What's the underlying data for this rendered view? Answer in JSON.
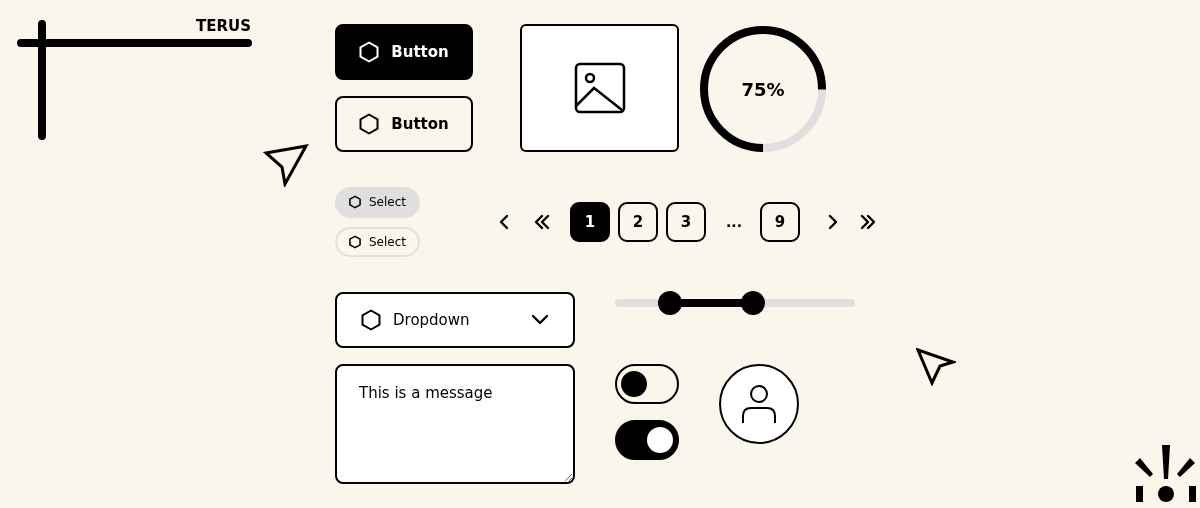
{
  "logo": {
    "text": "TERUS"
  },
  "buttons": [
    {
      "label": "Button",
      "kind": "filled"
    },
    {
      "label": "Button",
      "kind": "outline"
    }
  ],
  "progress": {
    "level": 0.75,
    "reading": "75%"
  },
  "chips": [
    {
      "label": "Select",
      "selected": true
    },
    {
      "label": "Select",
      "selected": false
    }
  ],
  "pagination": [
    {
      "kind": "prev"
    },
    {
      "kind": "first"
    },
    {
      "kind": "page",
      "label": "1",
      "selected": true
    },
    {
      "kind": "page",
      "label": "2",
      "selected": false
    },
    {
      "kind": "page",
      "label": "3",
      "selected": false
    },
    {
      "kind": "ellipsis",
      "label": "..."
    },
    {
      "kind": "page",
      "label": "9",
      "selected": false
    },
    {
      "kind": "next"
    },
    {
      "kind": "last"
    }
  ],
  "dropdown": {
    "label": "Dropdown"
  },
  "message": {
    "value": "This is a message"
  },
  "range_slider": {
    "thumbs": [
      {
        "level": 0.23
      },
      {
        "level": 0.575
      }
    ]
  },
  "toggles": [
    {
      "on": false
    },
    {
      "on": true
    }
  ]
}
